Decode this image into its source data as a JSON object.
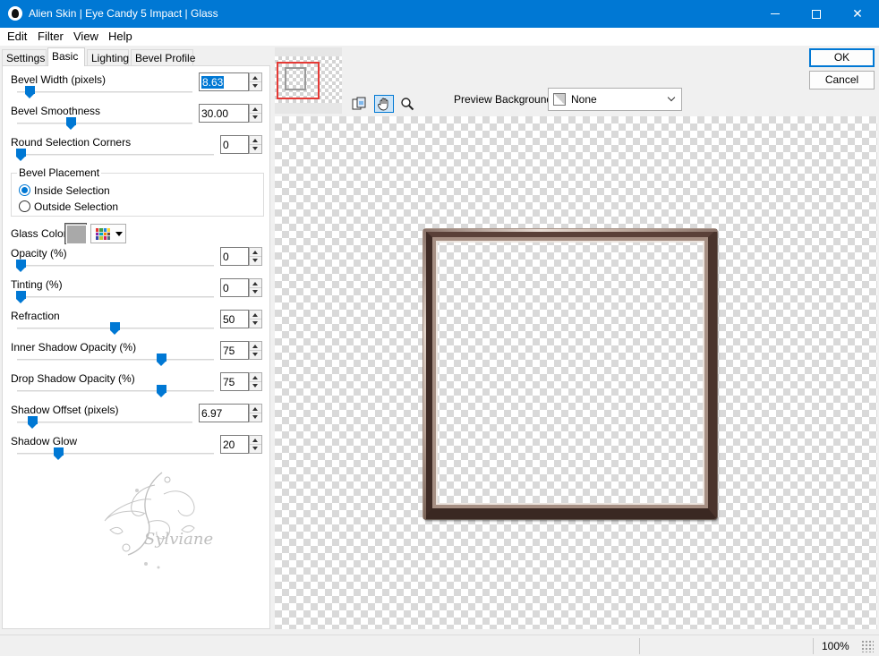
{
  "window": {
    "title": "Alien Skin | Eye Candy 5 Impact | Glass",
    "title_color": "#0078d4"
  },
  "menu": [
    "Edit",
    "Filter",
    "View",
    "Help"
  ],
  "tabs": [
    "Settings",
    "Basic",
    "Lighting",
    "Bevel Profile"
  ],
  "active_tab": "Basic",
  "controls": {
    "bevel_width": {
      "label": "Bevel Width (pixels)",
      "value": "8.63"
    },
    "bevel_smoothness": {
      "label": "Bevel Smoothness",
      "value": "30.00"
    },
    "round_corners": {
      "label": "Round Selection Corners",
      "value": "0"
    },
    "bevel_placement": {
      "title": "Bevel Placement",
      "options": [
        "Inside Selection",
        "Outside Selection"
      ],
      "selected": "Inside Selection"
    },
    "glass_color": {
      "label": "Glass Color",
      "color": "#a9a9a9"
    },
    "opacity": {
      "label": "Opacity (%)",
      "value": "0"
    },
    "tinting": {
      "label": "Tinting (%)",
      "value": "0"
    },
    "refraction": {
      "label": "Refraction",
      "value": "50"
    },
    "inner_shadow_opacity": {
      "label": "Inner Shadow Opacity (%)",
      "value": "75"
    },
    "drop_shadow_opacity": {
      "label": "Drop Shadow Opacity (%)",
      "value": "75"
    },
    "shadow_offset": {
      "label": "Shadow Offset (pixels)",
      "value": "6.97"
    },
    "shadow_glow": {
      "label": "Shadow Glow",
      "value": "20"
    }
  },
  "watermark": {
    "text": "Sylviane"
  },
  "preview_background": {
    "label": "Preview Background:",
    "value": "None"
  },
  "buttons": {
    "ok": "OK",
    "cancel": "Cancel"
  },
  "status": {
    "zoom": "100%"
  },
  "icons": [
    "app-icon",
    "minimize-icon",
    "maximize-icon",
    "close-icon",
    "preview-compare-icon",
    "hand-pan-icon",
    "zoom-icon",
    "color-grid-icon",
    "chevron-down-icon",
    "size-grip-icon"
  ]
}
